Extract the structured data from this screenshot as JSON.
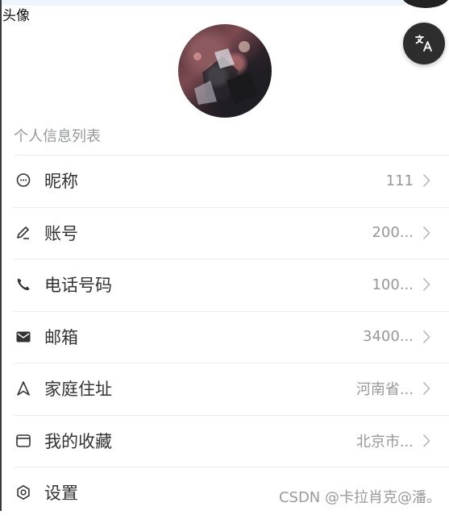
{
  "header": {
    "label": "头像"
  },
  "section": {
    "title": "个人信息列表"
  },
  "cells": [
    {
      "icon": "chat-bubble-icon",
      "title": "昵称",
      "value": "111"
    },
    {
      "icon": "edit-pen-icon",
      "title": "账号",
      "value": "200..."
    },
    {
      "icon": "phone-icon",
      "title": "电话号码",
      "value": "100..."
    },
    {
      "icon": "mail-icon",
      "title": "邮箱",
      "value": "3400..."
    },
    {
      "icon": "location-arrow-icon",
      "title": "家庭住址",
      "value": "河南省..."
    },
    {
      "icon": "folder-icon",
      "title": "我的收藏",
      "value": "北京市..."
    },
    {
      "icon": "gear-icon",
      "title": "设置",
      "value": ""
    }
  ],
  "watermark": "CSDN @卡拉肖克@潘。",
  "colors": {
    "divider": "#ebedf0",
    "muted": "#969799",
    "text": "#323233"
  }
}
